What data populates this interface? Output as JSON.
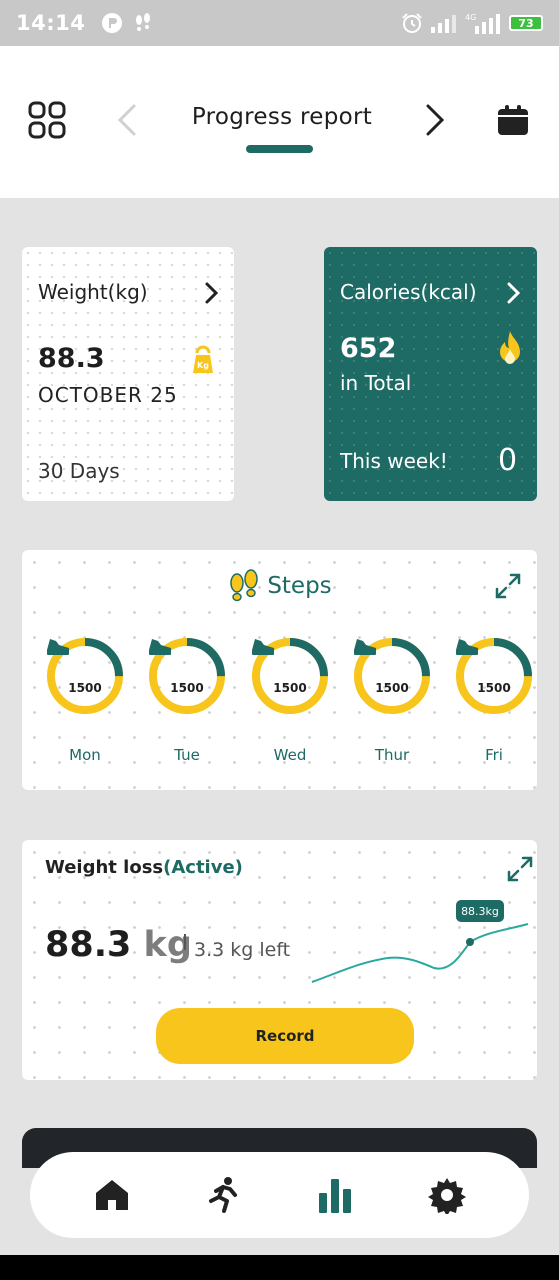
{
  "status_bar": {
    "time": "14:14",
    "network": "4G",
    "battery": "73",
    "icons": [
      "alarm-icon",
      "signal-icon",
      "battery-icon"
    ]
  },
  "header": {
    "title": "Progress report",
    "icons": [
      "grid-icon",
      "chevron-left-icon",
      "chevron-right-icon",
      "calendar-icon"
    ]
  },
  "weight_card": {
    "title": "Weight(kg)",
    "value": "88.3",
    "date": "OCTOBER 25",
    "days": "30 Days",
    "icon": "kettlebell-icon",
    "icon_label": "Kg"
  },
  "calories_card": {
    "title": "Calories(kcal)",
    "value": "652",
    "total_label": "in Total",
    "week_label": "This week!",
    "week_value": "0",
    "icon": "flame-icon"
  },
  "steps_card": {
    "title": "Steps",
    "days": [
      {
        "day": "Mon",
        "value": "1500"
      },
      {
        "day": "Tue",
        "value": "1500"
      },
      {
        "day": "Wed",
        "value": "1500"
      },
      {
        "day": "Thur",
        "value": "1500"
      },
      {
        "day": "Fri",
        "value": "1500"
      }
    ]
  },
  "weight_loss_card": {
    "title": "Weight loss",
    "status": "(Active)",
    "value": "88.3",
    "unit": "kg",
    "left_text": "3.3 kg left",
    "tooltip": "88.3kg",
    "record_label": "Record"
  },
  "bottom_nav": {
    "items": [
      "home-icon",
      "running-icon",
      "stats-icon",
      "settings-icon"
    ]
  },
  "colors": {
    "primary": "#1d6b64",
    "accent": "#f7c51b",
    "background": "#e3e3e3"
  }
}
